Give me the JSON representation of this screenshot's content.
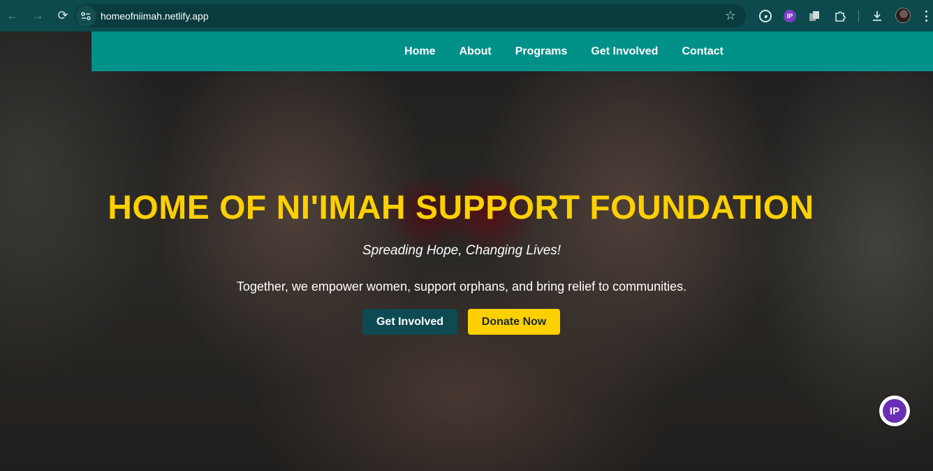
{
  "browser": {
    "url": "homeofniimah.netlify.app",
    "back_icon": "←",
    "forward_icon": "→",
    "reload_icon": "⟳",
    "star_icon": "☆",
    "ext_ip_label": "IP"
  },
  "nav": {
    "items": [
      {
        "label": "Home"
      },
      {
        "label": "About"
      },
      {
        "label": "Programs"
      },
      {
        "label": "Get Involved"
      },
      {
        "label": "Contact"
      }
    ]
  },
  "hero": {
    "title": "HOME OF NI'IMAH SUPPORT FOUNDATION",
    "tagline": "Spreading Hope, Changing Lives!",
    "subtext": "Together, we empower women, support orphans, and bring relief to communities.",
    "primary_button": "Get Involved",
    "donate_button": "Donate Now"
  },
  "floating_badge": {
    "label": "IP"
  },
  "colors": {
    "chrome": "#0c4a4d",
    "navbar": "#00908a",
    "title": "#ffd000",
    "primary_button": "#0d4a52",
    "donate_button": "#ffd000"
  }
}
